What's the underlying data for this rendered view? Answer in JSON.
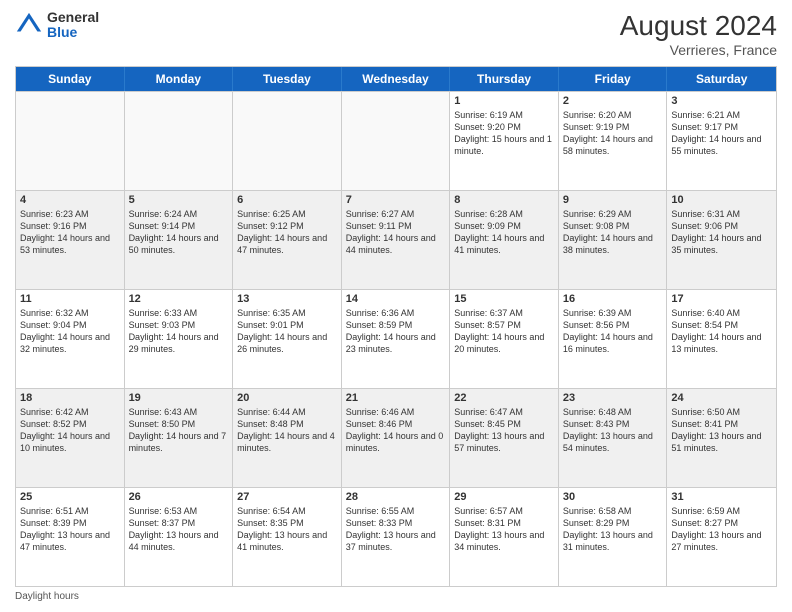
{
  "header": {
    "logo_general": "General",
    "logo_blue": "Blue",
    "month_year": "August 2024",
    "location": "Verrieres, France"
  },
  "days_of_week": [
    "Sunday",
    "Monday",
    "Tuesday",
    "Wednesday",
    "Thursday",
    "Friday",
    "Saturday"
  ],
  "footer": "Daylight hours",
  "weeks": [
    [
      {
        "day": "",
        "info": ""
      },
      {
        "day": "",
        "info": ""
      },
      {
        "day": "",
        "info": ""
      },
      {
        "day": "",
        "info": ""
      },
      {
        "day": "1",
        "info": "Sunrise: 6:19 AM\nSunset: 9:20 PM\nDaylight: 15 hours\nand 1 minute."
      },
      {
        "day": "2",
        "info": "Sunrise: 6:20 AM\nSunset: 9:19 PM\nDaylight: 14 hours\nand 58 minutes."
      },
      {
        "day": "3",
        "info": "Sunrise: 6:21 AM\nSunset: 9:17 PM\nDaylight: 14 hours\nand 55 minutes."
      }
    ],
    [
      {
        "day": "4",
        "info": "Sunrise: 6:23 AM\nSunset: 9:16 PM\nDaylight: 14 hours\nand 53 minutes."
      },
      {
        "day": "5",
        "info": "Sunrise: 6:24 AM\nSunset: 9:14 PM\nDaylight: 14 hours\nand 50 minutes."
      },
      {
        "day": "6",
        "info": "Sunrise: 6:25 AM\nSunset: 9:12 PM\nDaylight: 14 hours\nand 47 minutes."
      },
      {
        "day": "7",
        "info": "Sunrise: 6:27 AM\nSunset: 9:11 PM\nDaylight: 14 hours\nand 44 minutes."
      },
      {
        "day": "8",
        "info": "Sunrise: 6:28 AM\nSunset: 9:09 PM\nDaylight: 14 hours\nand 41 minutes."
      },
      {
        "day": "9",
        "info": "Sunrise: 6:29 AM\nSunset: 9:08 PM\nDaylight: 14 hours\nand 38 minutes."
      },
      {
        "day": "10",
        "info": "Sunrise: 6:31 AM\nSunset: 9:06 PM\nDaylight: 14 hours\nand 35 minutes."
      }
    ],
    [
      {
        "day": "11",
        "info": "Sunrise: 6:32 AM\nSunset: 9:04 PM\nDaylight: 14 hours\nand 32 minutes."
      },
      {
        "day": "12",
        "info": "Sunrise: 6:33 AM\nSunset: 9:03 PM\nDaylight: 14 hours\nand 29 minutes."
      },
      {
        "day": "13",
        "info": "Sunrise: 6:35 AM\nSunset: 9:01 PM\nDaylight: 14 hours\nand 26 minutes."
      },
      {
        "day": "14",
        "info": "Sunrise: 6:36 AM\nSunset: 8:59 PM\nDaylight: 14 hours\nand 23 minutes."
      },
      {
        "day": "15",
        "info": "Sunrise: 6:37 AM\nSunset: 8:57 PM\nDaylight: 14 hours\nand 20 minutes."
      },
      {
        "day": "16",
        "info": "Sunrise: 6:39 AM\nSunset: 8:56 PM\nDaylight: 14 hours\nand 16 minutes."
      },
      {
        "day": "17",
        "info": "Sunrise: 6:40 AM\nSunset: 8:54 PM\nDaylight: 14 hours\nand 13 minutes."
      }
    ],
    [
      {
        "day": "18",
        "info": "Sunrise: 6:42 AM\nSunset: 8:52 PM\nDaylight: 14 hours\nand 10 minutes."
      },
      {
        "day": "19",
        "info": "Sunrise: 6:43 AM\nSunset: 8:50 PM\nDaylight: 14 hours\nand 7 minutes."
      },
      {
        "day": "20",
        "info": "Sunrise: 6:44 AM\nSunset: 8:48 PM\nDaylight: 14 hours\nand 4 minutes."
      },
      {
        "day": "21",
        "info": "Sunrise: 6:46 AM\nSunset: 8:46 PM\nDaylight: 14 hours\nand 0 minutes."
      },
      {
        "day": "22",
        "info": "Sunrise: 6:47 AM\nSunset: 8:45 PM\nDaylight: 13 hours\nand 57 minutes."
      },
      {
        "day": "23",
        "info": "Sunrise: 6:48 AM\nSunset: 8:43 PM\nDaylight: 13 hours\nand 54 minutes."
      },
      {
        "day": "24",
        "info": "Sunrise: 6:50 AM\nSunset: 8:41 PM\nDaylight: 13 hours\nand 51 minutes."
      }
    ],
    [
      {
        "day": "25",
        "info": "Sunrise: 6:51 AM\nSunset: 8:39 PM\nDaylight: 13 hours\nand 47 minutes."
      },
      {
        "day": "26",
        "info": "Sunrise: 6:53 AM\nSunset: 8:37 PM\nDaylight: 13 hours\nand 44 minutes."
      },
      {
        "day": "27",
        "info": "Sunrise: 6:54 AM\nSunset: 8:35 PM\nDaylight: 13 hours\nand 41 minutes."
      },
      {
        "day": "28",
        "info": "Sunrise: 6:55 AM\nSunset: 8:33 PM\nDaylight: 13 hours\nand 37 minutes."
      },
      {
        "day": "29",
        "info": "Sunrise: 6:57 AM\nSunset: 8:31 PM\nDaylight: 13 hours\nand 34 minutes."
      },
      {
        "day": "30",
        "info": "Sunrise: 6:58 AM\nSunset: 8:29 PM\nDaylight: 13 hours\nand 31 minutes."
      },
      {
        "day": "31",
        "info": "Sunrise: 6:59 AM\nSunset: 8:27 PM\nDaylight: 13 hours\nand 27 minutes."
      }
    ]
  ]
}
